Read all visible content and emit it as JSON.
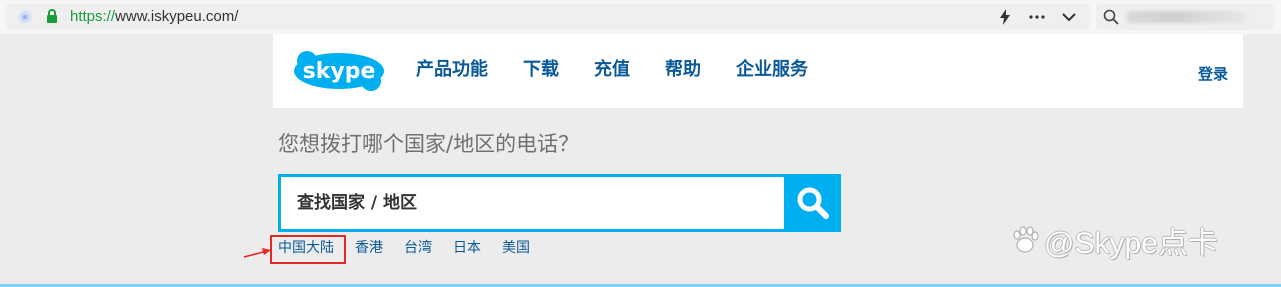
{
  "browser": {
    "url_scheme": "https://",
    "url_host": "www.iskypeu.com/",
    "icons": [
      "page-icon",
      "lock-icon",
      "bolt-icon",
      "more-icon",
      "chevron-down-icon",
      "search-icon"
    ]
  },
  "header": {
    "logo_text": "skype",
    "nav": [
      "产品功能",
      "下载",
      "充值",
      "帮助",
      "企业服务"
    ],
    "login": "登录"
  },
  "main": {
    "question": "您想拨打哪个国家/地区的电话？",
    "search_placeholder": "查找国家 / 地区",
    "quick_links": [
      "中国大陆",
      "香港",
      "台湾",
      "日本",
      "美国"
    ]
  },
  "watermark": {
    "text": "@Skype点卡"
  },
  "colors": {
    "brand_blue": "#00aff0",
    "link_blue": "#0a5a99",
    "highlight_red": "#e42828",
    "url_green": "#1a9b3c"
  }
}
